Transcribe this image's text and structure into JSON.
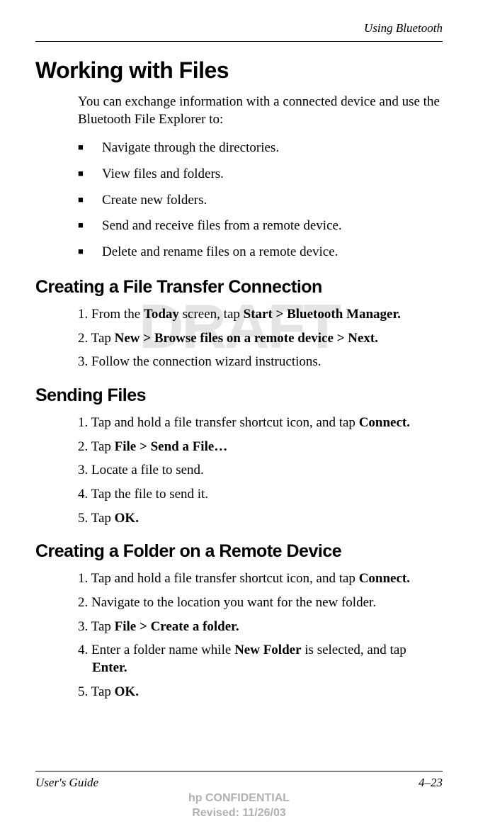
{
  "header": {
    "chapter": "Using Bluetooth"
  },
  "watermark": "DRAFT",
  "h1": "Working with Files",
  "intro": "You can exchange information with a connected device and use the Bluetooth File Explorer to:",
  "bullets": [
    "Navigate through the directories.",
    "View files and folders.",
    "Create new folders.",
    "Send and receive files from a remote device.",
    "Delete and rename files on a remote device."
  ],
  "sections": [
    {
      "title": "Creating a File Transfer Connection",
      "steps": [
        {
          "num": "1.",
          "pre": "From the ",
          "bold1": "Today",
          "mid": " screen, tap ",
          "bold2": "Start > Bluetooth Manager.",
          "post": ""
        },
        {
          "num": "2.",
          "pre": "Tap ",
          "bold1": "New > Browse files on a remote device > Next.",
          "mid": "",
          "bold2": "",
          "post": ""
        },
        {
          "num": "3.",
          "pre": "Follow the connection wizard instructions.",
          "bold1": "",
          "mid": "",
          "bold2": "",
          "post": ""
        }
      ]
    },
    {
      "title": "Sending Files",
      "steps": [
        {
          "num": "1.",
          "pre": "Tap and hold a file transfer shortcut icon, and tap ",
          "bold1": "Connect.",
          "mid": "",
          "bold2": "",
          "post": ""
        },
        {
          "num": "2.",
          "pre": "Tap ",
          "bold1": "File > Send a File…",
          "mid": "",
          "bold2": "",
          "post": ""
        },
        {
          "num": "3.",
          "pre": "Locate a file to send.",
          "bold1": "",
          "mid": "",
          "bold2": "",
          "post": ""
        },
        {
          "num": "4.",
          "pre": "Tap the file to send it.",
          "bold1": "",
          "mid": "",
          "bold2": "",
          "post": ""
        },
        {
          "num": "5.",
          "pre": "Tap ",
          "bold1": "OK.",
          "mid": "",
          "bold2": "",
          "post": ""
        }
      ]
    },
    {
      "title": "Creating a Folder on a Remote Device",
      "steps": [
        {
          "num": "1.",
          "pre": "Tap and hold a file transfer shortcut icon, and tap ",
          "bold1": "Connect.",
          "mid": "",
          "bold2": "",
          "post": ""
        },
        {
          "num": "2.",
          "pre": "Navigate to the location you want for the new folder.",
          "bold1": "",
          "mid": "",
          "bold2": "",
          "post": ""
        },
        {
          "num": "3.",
          "pre": "Tap ",
          "bold1": "File > Create a folder.",
          "mid": "",
          "bold2": "",
          "post": ""
        },
        {
          "num": "4.",
          "pre": "Enter a folder name while ",
          "bold1": "New Folder",
          "mid": " is selected, and tap ",
          "bold2": "Enter.",
          "post": ""
        },
        {
          "num": "5.",
          "pre": "Tap ",
          "bold1": "OK.",
          "mid": "",
          "bold2": "",
          "post": ""
        }
      ]
    }
  ],
  "footer": {
    "left": "User's Guide",
    "right": "4–23",
    "confidential_line1": "hp CONFIDENTIAL",
    "confidential_line2": "Revised: 11/26/03"
  }
}
